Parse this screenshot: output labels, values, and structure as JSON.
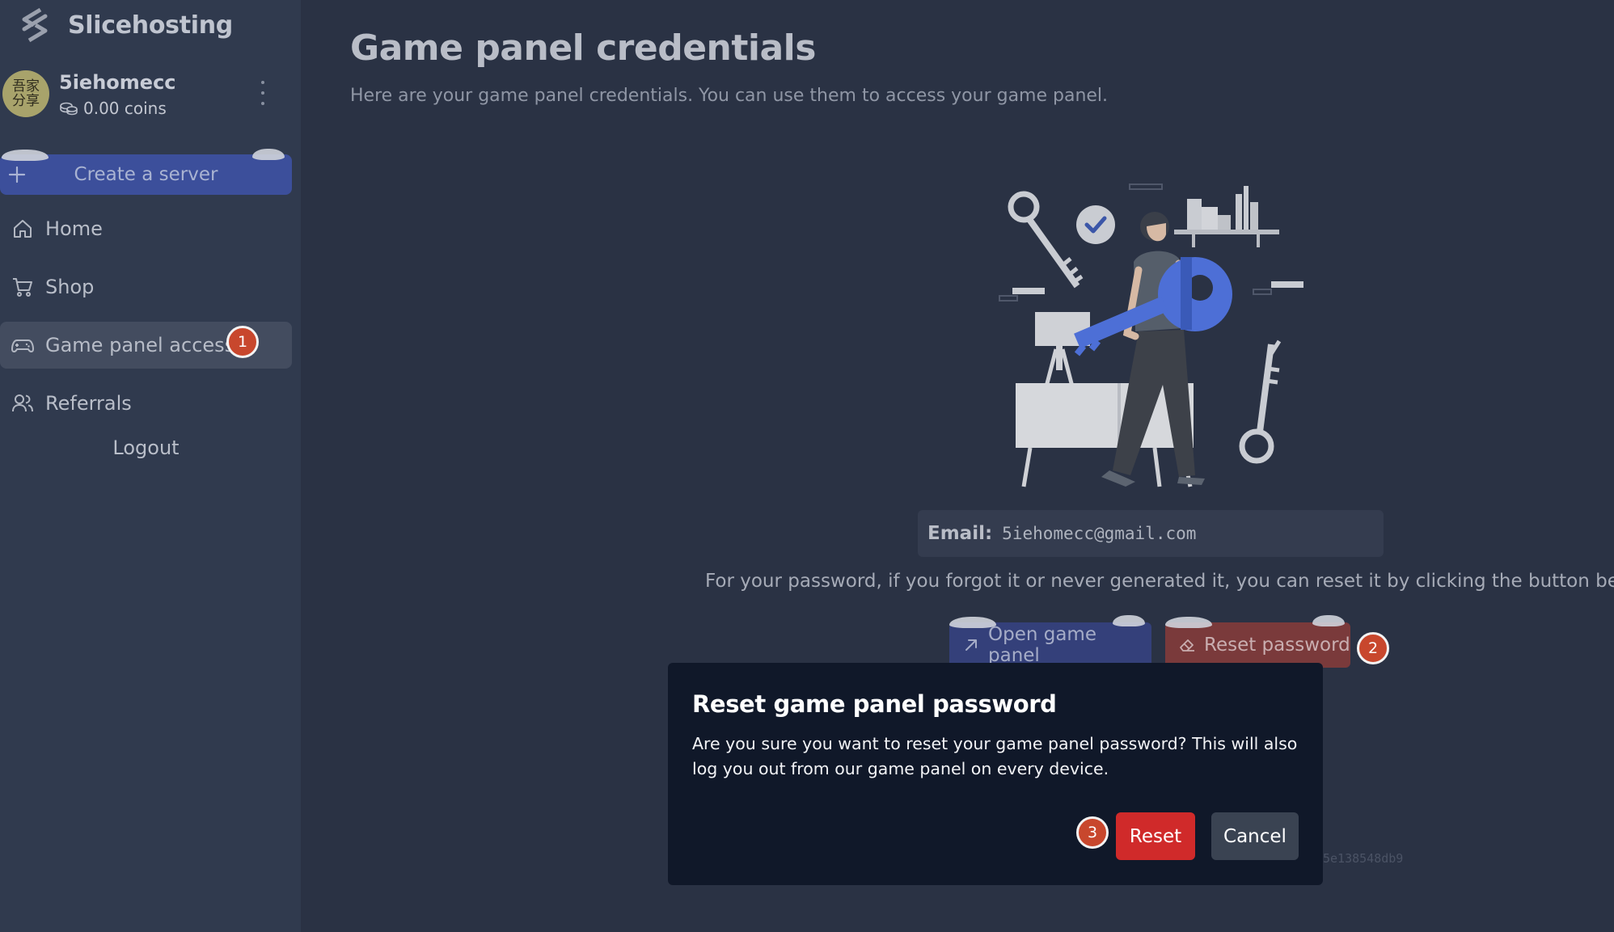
{
  "brand": {
    "name": "Slicehosting",
    "icon": "slicehosting-logo-icon"
  },
  "user": {
    "username": "5iehomecc",
    "avatar_text": "吾家分享",
    "coins": "0.00 coins",
    "coins_icon": "coins-icon",
    "menu_icon": "kebab-menu-icon"
  },
  "sidebar": {
    "create_server_label": "Create a server",
    "items": [
      {
        "label": "Home",
        "icon": "home-icon",
        "active": false
      },
      {
        "label": "Shop",
        "icon": "cart-icon",
        "active": false
      },
      {
        "label": "Game panel access",
        "icon": "gamepad-icon",
        "active": true
      },
      {
        "label": "Referrals",
        "icon": "users-icon",
        "active": false
      }
    ],
    "logout_label": "Logout"
  },
  "main": {
    "title": "Game panel credentials",
    "subtitle": "Here are your game panel credentials. You can use them to access your game panel.",
    "email_label": "Email:",
    "email_value": "5iehomecc@gmail.com",
    "password_hint": "For your password, if you forgot it or never generated it, you can reset it by clicking the button below.",
    "open_panel_label": "Open game panel",
    "reset_password_label": "Reset password",
    "footer_hash": "5e138548db9"
  },
  "modal": {
    "title": "Reset game panel password",
    "body": "Are you sure you want to reset your game panel password? This will also log you out from our game panel on every device.",
    "confirm_label": "Reset",
    "cancel_label": "Cancel"
  },
  "markers": [
    "1",
    "2",
    "3"
  ],
  "colors": {
    "sidebar_bg": "#303a4e",
    "main_bg": "#2a3244",
    "primary": "#3c4f9b",
    "danger": "#d02a2a",
    "modal_bg": "#101829",
    "marker": "#c8472d"
  }
}
